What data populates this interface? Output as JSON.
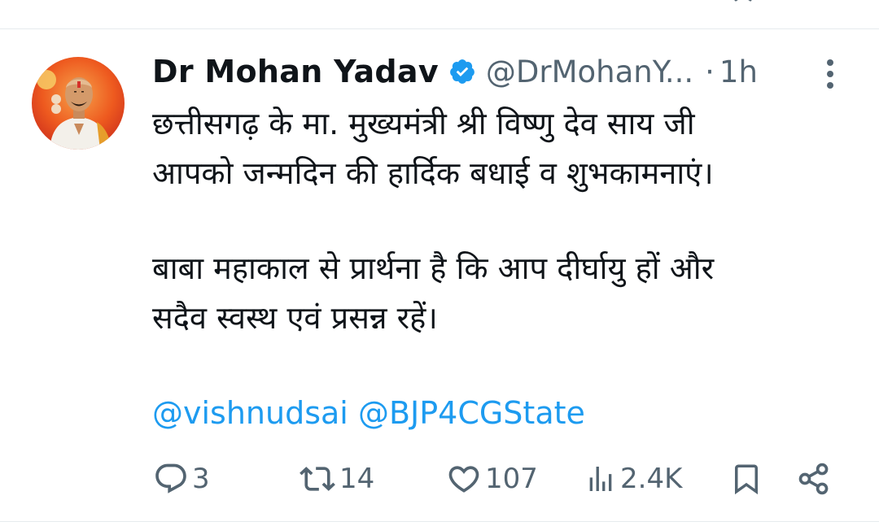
{
  "tweet": {
    "display_name": "Dr Mohan Yadav",
    "handle": "@DrMohanY...",
    "separator": "·",
    "time": "1h",
    "text_lines": [
      "छत्तीसगढ़ के मा. मुख्यमंत्री श्री विष्णु देव साय जी",
      "आपको जन्मदिन की हार्दिक बधाई व शुभकामनाएं।"
    ],
    "text_lines_2": [
      "बाबा महाकाल से प्रार्थना है कि आप दीर्घायु हों और",
      "सदैव स्वस्थ एवं प्रसन्न रहें।"
    ],
    "mentions": [
      "@vishnudsai",
      "@BJP4CGState"
    ]
  },
  "actions": {
    "reply_count": "3",
    "retweet_count": "14",
    "like_count": "107",
    "views_count": "2.4K"
  },
  "icons": {
    "verified": "verified-badge-icon",
    "more": "more-vertical-icon",
    "reply": "reply-icon",
    "retweet": "retweet-icon",
    "like": "heart-icon",
    "views": "views-icon",
    "bookmark": "bookmark-icon",
    "share": "share-icon"
  },
  "colors": {
    "text": "#0f1419",
    "secondary": "#536471",
    "link": "#1d9bf0",
    "verified": "#1d9bf0",
    "divider": "#e6ebee"
  }
}
